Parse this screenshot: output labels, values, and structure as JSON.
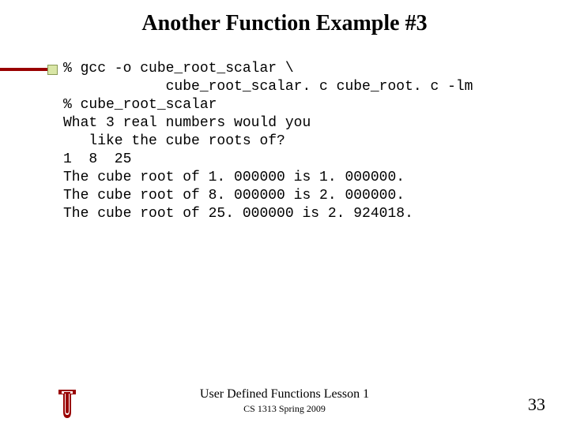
{
  "title": "Another Function Example #3",
  "code": "% gcc -o cube_root_scalar \\\n            cube_root_scalar. c cube_root. c -lm\n% cube_root_scalar\nWhat 3 real numbers would you\n   like the cube roots of?\n1  8  25\nThe cube root of 1. 000000 is 1. 000000.\nThe cube root of 8. 000000 is 2. 000000.\nThe cube root of 25. 000000 is 2. 924018.",
  "footer": {
    "line1": "User Defined Functions Lesson 1",
    "line2": "CS 1313 Spring 2009"
  },
  "page_number": "33"
}
